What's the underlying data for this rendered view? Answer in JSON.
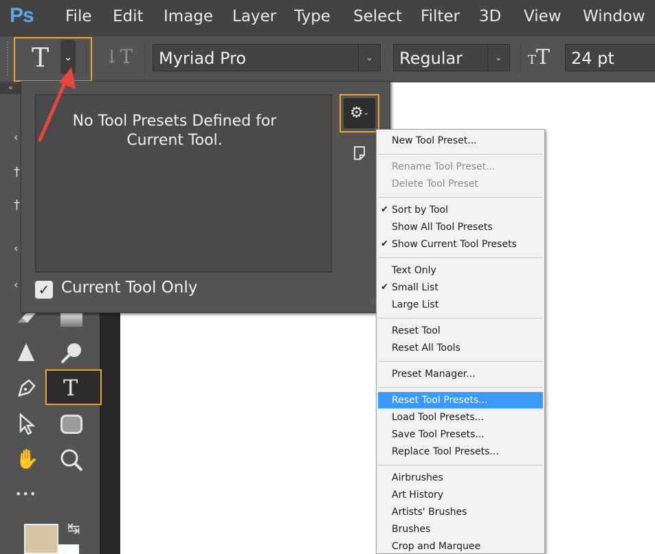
{
  "app": {
    "logo": "Ps",
    "menu": [
      "File",
      "Edit",
      "Image",
      "Layer",
      "Type",
      "Select",
      "Filter",
      "3D",
      "View",
      "Window"
    ]
  },
  "options_bar": {
    "tool_glyph": "T",
    "orient_glyph": "↓T",
    "font_family": "Myriad Pro",
    "font_style": "Regular",
    "size_glyph": "тT",
    "font_size": "24 pt"
  },
  "preset_panel": {
    "empty_message": "No Tool Presets Defined for\nCurrent Tool.",
    "current_tool_only_label": "Current Tool Only",
    "current_tool_only_checked": true
  },
  "context_menu": {
    "highlighted": "Reset Tool Presets...",
    "groups": [
      [
        {
          "label": "New Tool Preset...",
          "enabled": true,
          "checked": false
        }
      ],
      [
        {
          "label": "Rename Tool Preset...",
          "enabled": false,
          "checked": false
        },
        {
          "label": "Delete Tool Preset",
          "enabled": false,
          "checked": false
        }
      ],
      [
        {
          "label": "Sort by Tool",
          "enabled": true,
          "checked": true
        },
        {
          "label": "Show All Tool Presets",
          "enabled": true,
          "checked": false
        },
        {
          "label": "Show Current Tool Presets",
          "enabled": true,
          "checked": true
        }
      ],
      [
        {
          "label": "Text Only",
          "enabled": true,
          "checked": false
        },
        {
          "label": "Small List",
          "enabled": true,
          "checked": true
        },
        {
          "label": "Large List",
          "enabled": true,
          "checked": false
        }
      ],
      [
        {
          "label": "Reset Tool",
          "enabled": true,
          "checked": false
        },
        {
          "label": "Reset All Tools",
          "enabled": true,
          "checked": false
        }
      ],
      [
        {
          "label": "Preset Manager...",
          "enabled": true,
          "checked": false
        }
      ],
      [
        {
          "label": "Reset Tool Presets...",
          "enabled": true,
          "checked": false
        },
        {
          "label": "Load Tool Presets...",
          "enabled": true,
          "checked": false
        },
        {
          "label": "Save Tool Presets...",
          "enabled": true,
          "checked": false
        },
        {
          "label": "Replace Tool Presets...",
          "enabled": true,
          "checked": false
        }
      ],
      [
        {
          "label": "Airbrushes",
          "enabled": true,
          "checked": false
        },
        {
          "label": "Art History",
          "enabled": true,
          "checked": false
        },
        {
          "label": "Artists' Brushes",
          "enabled": true,
          "checked": false
        },
        {
          "label": "Brushes",
          "enabled": true,
          "checked": false
        },
        {
          "label": "Crop and Marquee",
          "enabled": true,
          "checked": false
        }
      ]
    ]
  },
  "toolbar": {
    "tools": [
      "eraser-icon",
      "gradient-icon",
      "blur-icon",
      "dodge-icon",
      "pen-icon",
      "type-icon",
      "path-selection-icon",
      "rectangle-icon",
      "hand-icon",
      "zoom-icon",
      "more-tools-icon"
    ],
    "type_tool_glyph": "T",
    "more_glyph": "•••",
    "foreground_color": "#d5c5a2",
    "background_color": "#ffffff"
  },
  "colors": {
    "highlight_border": "#f0a623",
    "menu_highlight": "#3b99fc",
    "annotation_arrow": "#e8453c"
  }
}
